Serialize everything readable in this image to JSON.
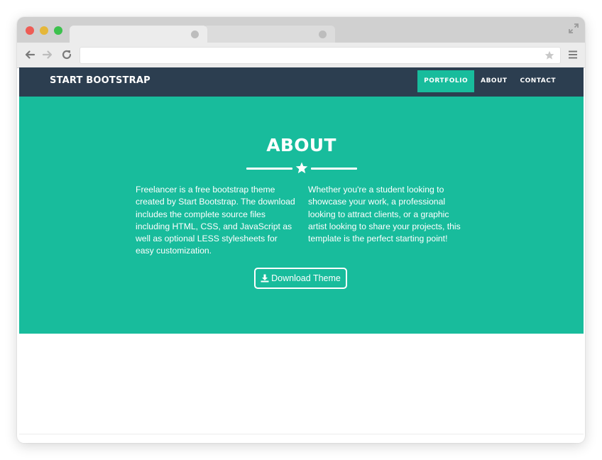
{
  "browser": {
    "address_bar": {
      "value": "",
      "placeholder": ""
    },
    "icons": {
      "back": "back-arrow-icon",
      "forward": "forward-arrow-icon",
      "reload": "reload-icon",
      "bookmark": "star-icon",
      "menu": "hamburger-menu-icon",
      "fullscreen": "fullscreen-icon"
    }
  },
  "site": {
    "brand": "START BOOTSTRAP",
    "nav_items": [
      {
        "label": "PORTFOLIO",
        "active": true
      },
      {
        "label": "ABOUT",
        "active": false
      },
      {
        "label": "CONTACT",
        "active": false
      }
    ]
  },
  "about": {
    "title": "ABOUT",
    "text_left": "Freelancer is a free bootstrap theme created by Start Bootstrap. The download includes the complete source files including HTML, CSS, and JavaScript as well as optional LESS stylesheets for easy customization.",
    "text_right": "Whether you're a student looking to showcase your work, a professional looking to attract clients, or a graphic artist looking to share your projects, this template is the perfect starting point!",
    "download_button": "Download Theme"
  },
  "colors": {
    "navbar": "#2c3e50",
    "accent": "#18bc9c",
    "text_light": "#ffffff"
  }
}
